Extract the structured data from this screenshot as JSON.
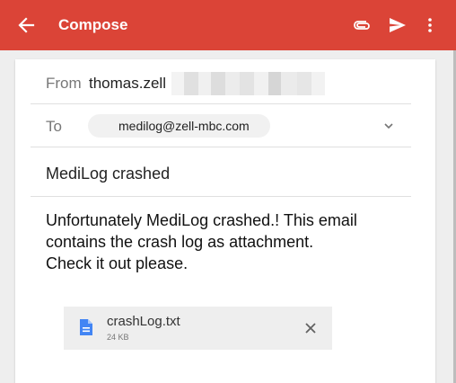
{
  "appbar": {
    "title": "Compose",
    "color": "#db4437",
    "icons": [
      "back-arrow-icon",
      "attach-icon",
      "send-icon",
      "more-vert-icon"
    ]
  },
  "compose": {
    "from_label": "From",
    "from_value": "thomas.zell",
    "to_label": "To",
    "to_recipient": "medilog@zell-mbc.com",
    "subject": "MediLog crashed",
    "body_lines": [
      "Unfortunately MediLog crashed.! This email",
      "contains the crash log as attachment.",
      "Check it out please."
    ]
  },
  "attachment": {
    "name": "crashLog.txt",
    "size": "24 KB",
    "icon": "document-icon",
    "icon_color": "#4285f4"
  }
}
